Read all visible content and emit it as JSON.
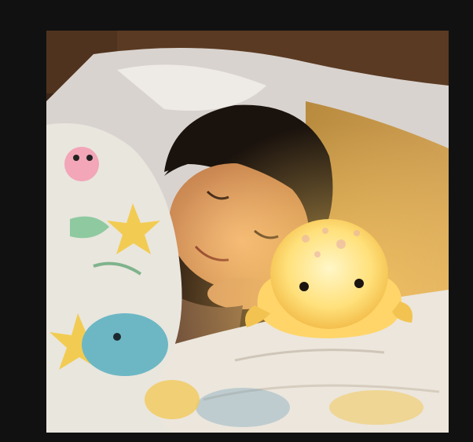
{
  "background_color": "#111111",
  "photo": {
    "subject": "child-sleeping-with-octopus-night-light",
    "palette": {
      "headboard": "#5a3a22",
      "pillow": "#c79a4a",
      "blanket": "#e8e2d8",
      "hair": "#1a120d",
      "skin": "#e0a06a",
      "lamp_glow": "#ffe27a"
    }
  }
}
